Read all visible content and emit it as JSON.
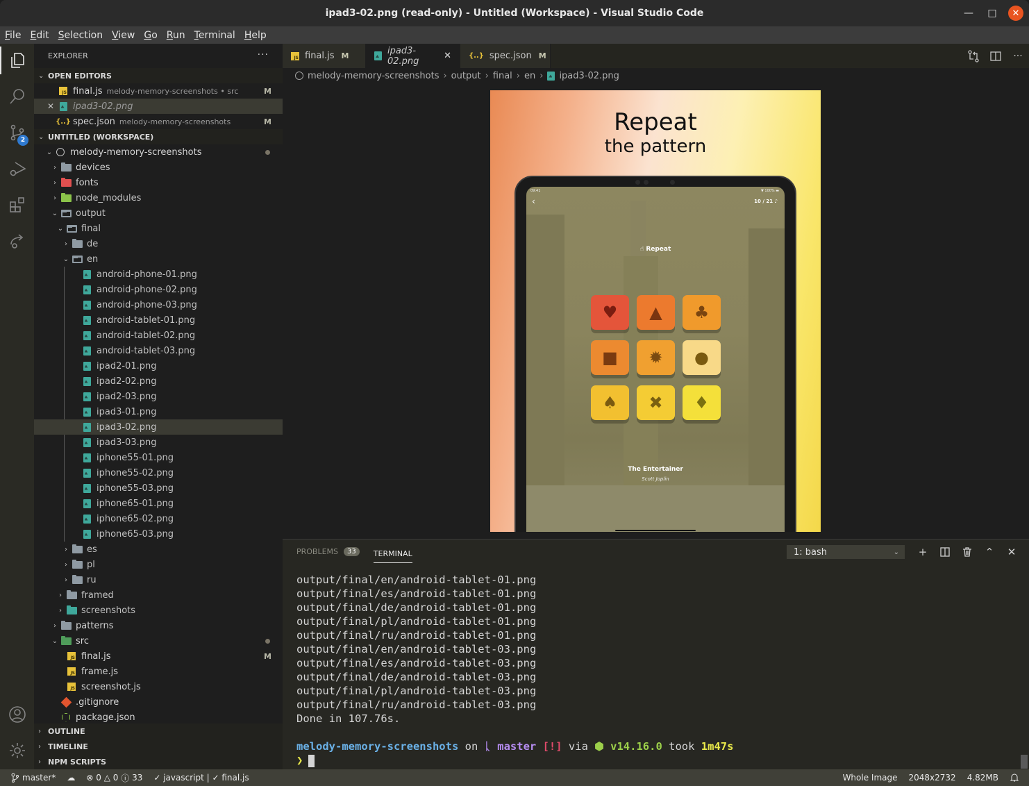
{
  "window": {
    "title": "ipad3-02.png (read-only) - Untitled (Workspace) - Visual Studio Code",
    "minimize": "—",
    "maximize": "□",
    "close": "✕"
  },
  "menu": [
    {
      "key": "F",
      "rest": "ile"
    },
    {
      "key": "E",
      "rest": "dit"
    },
    {
      "key": "S",
      "rest": "election"
    },
    {
      "key": "V",
      "rest": "iew"
    },
    {
      "key": "G",
      "rest": "o"
    },
    {
      "key": "R",
      "rest": "un"
    },
    {
      "key": "T",
      "rest": "erminal"
    },
    {
      "key": "H",
      "rest": "elp"
    }
  ],
  "activity": {
    "scm_badge": "2"
  },
  "explorer": {
    "title": "EXPLORER",
    "more": "···",
    "open_editors_label": "OPEN EDITORS",
    "open_editors": [
      {
        "name": "final.js",
        "desc": "melody-memory-screenshots • src",
        "badge": "M",
        "icon": "js-icon"
      },
      {
        "name": "ipad3-02.png",
        "desc": "",
        "badge": "",
        "icon": "image-icon",
        "close": "✕"
      },
      {
        "name": "spec.json",
        "desc": "melody-memory-screenshots",
        "badge": "M",
        "icon": "json-icon"
      }
    ],
    "workspace_label": "UNTITLED (WORKSPACE)",
    "root": "melody-memory-screenshots",
    "tree": {
      "devices": "devices",
      "fonts": "fonts",
      "node_modules": "node_modules",
      "output": "output",
      "final": "final",
      "de": "de",
      "en": "en",
      "en_files": [
        "android-phone-01.png",
        "android-phone-02.png",
        "android-phone-03.png",
        "android-tablet-01.png",
        "android-tablet-02.png",
        "android-tablet-03.png",
        "ipad2-01.png",
        "ipad2-02.png",
        "ipad2-03.png",
        "ipad3-01.png",
        "ipad3-02.png",
        "ipad3-03.png",
        "iphone55-01.png",
        "iphone55-02.png",
        "iphone55-03.png",
        "iphone65-01.png",
        "iphone65-02.png",
        "iphone65-03.png"
      ],
      "es": "es",
      "pl": "pl",
      "ru": "ru",
      "framed": "framed",
      "screenshots": "screenshots",
      "patterns": "patterns",
      "src": "src",
      "src_files": [
        {
          "name": "final.js",
          "badge": "M"
        },
        {
          "name": "frame.js",
          "badge": ""
        },
        {
          "name": "screenshot.js",
          "badge": ""
        }
      ],
      "gitignore": ".gitignore",
      "package_json": "package.json"
    },
    "outline_label": "OUTLINE",
    "timeline_label": "TIMELINE",
    "npm_label": "NPM SCRIPTS"
  },
  "tabs": [
    {
      "name": "final.js",
      "mark": "M"
    },
    {
      "name": "ipad3-02.png",
      "close": "✕"
    },
    {
      "name": "spec.json",
      "mark": "M"
    }
  ],
  "breadcrumb": [
    "melody-memory-screenshots",
    "output",
    "final",
    "en",
    "ipad3-02.png"
  ],
  "breadcrumb_sep": "›",
  "preview": {
    "headline": "Repeat",
    "subheadline": "the pattern",
    "status_time": "09:41",
    "status_battery": "▼ 100% ▬",
    "back": "‹",
    "level": "10 / 21 ♪",
    "prompt": "☝ Repeat",
    "tiles": [
      {
        "symbol": "♥",
        "color": "#e4553a",
        "fg": "#7a1d10"
      },
      {
        "symbol": "▲",
        "color": "#ec7a2e",
        "fg": "#7a3510"
      },
      {
        "symbol": "♣",
        "color": "#f09a2c",
        "fg": "#7a4510"
      },
      {
        "symbol": "■",
        "color": "#ec8a30",
        "fg": "#7a3a10"
      },
      {
        "symbol": "✹",
        "color": "#f0a030",
        "fg": "#7a4a10"
      },
      {
        "symbol": "●",
        "color": "#f8d988",
        "fg": "#7a5a10"
      },
      {
        "symbol": "♠",
        "color": "#f2c030",
        "fg": "#7a5a10"
      },
      {
        "symbol": "✖",
        "color": "#f4cc34",
        "fg": "#7a6010"
      },
      {
        "symbol": "♦",
        "color": "#f4e03a",
        "fg": "#7a7010"
      }
    ],
    "song": "The Entertainer",
    "artist": "Scott Joplin"
  },
  "panel": {
    "problems_label": "PROBLEMS",
    "problems_count": "33",
    "terminal_label": "TERMINAL",
    "terminal_select": "1: bash",
    "output_lines": [
      "output/final/en/android-tablet-01.png",
      "output/final/es/android-tablet-01.png",
      "output/final/de/android-tablet-01.png",
      "output/final/pl/android-tablet-01.png",
      "output/final/ru/android-tablet-01.png",
      "output/final/en/android-tablet-03.png",
      "output/final/es/android-tablet-03.png",
      "output/final/de/android-tablet-03.png",
      "output/final/pl/android-tablet-03.png",
      "output/final/ru/android-tablet-03.png",
      "Done in 107.76s."
    ],
    "prompt": {
      "dir": "melody-memory-screenshots",
      "on": " on ",
      "branch": "ᚳ master",
      "status": "[!]",
      "via": " via ",
      "node": "⬢ v14.16.0",
      "took": " took ",
      "duration": "1m47s",
      "symbol": "❯"
    }
  },
  "status": {
    "branch": "master*",
    "sync": "☁",
    "errors": "0",
    "warnings": "0",
    "infos": "33",
    "lang_check": "✓ javascript |",
    "file_check": "✓ final.js",
    "zoom": "Whole Image",
    "dimensions": "2048x2732",
    "size": "4.82MB",
    "bell": "🔔"
  }
}
